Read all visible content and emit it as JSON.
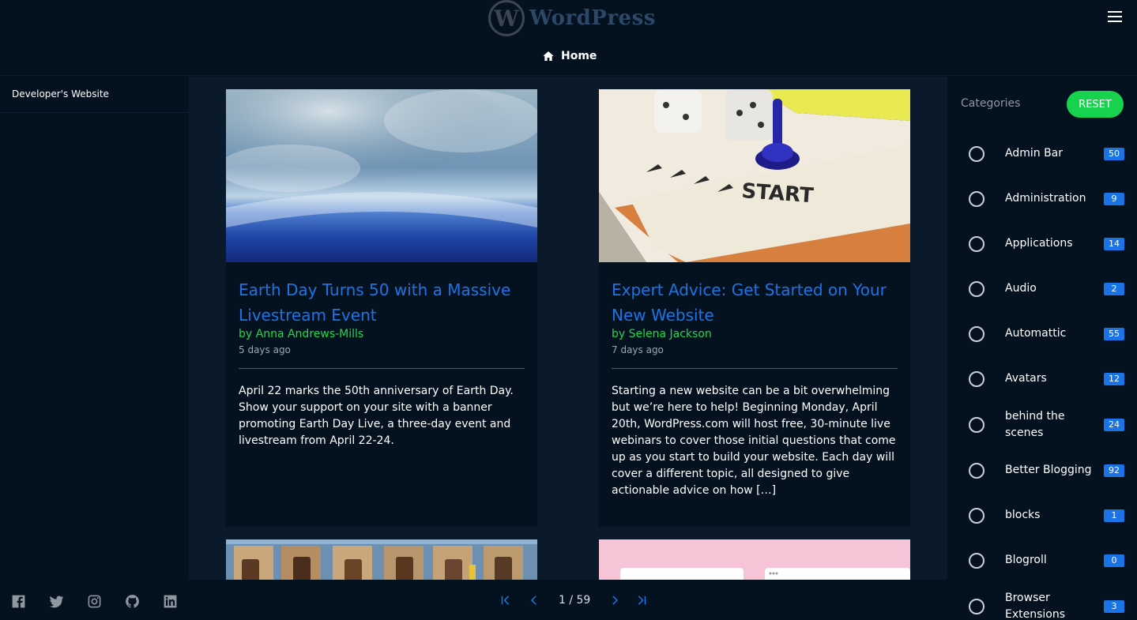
{
  "header": {
    "logo_mark": "W",
    "logo_text": "WordPress",
    "home_label": "Home"
  },
  "left_sidebar": {
    "link_label": "Developer's Website",
    "social_icons": [
      "facebook-icon",
      "twitter-icon",
      "instagram-icon",
      "github-icon",
      "linkedin-icon"
    ]
  },
  "posts": [
    {
      "title": "Earth Day Turns 50 with a Massive Livestream Event",
      "by": "by",
      "author": "Anna Andrews-Mills",
      "time": "5 days ago",
      "excerpt": "April 22 marks the 50th anniversary of Earth Day. Show your support on your site with a banner promoting Earth Day Live, a three-day event and livestream from April 22-24."
    },
    {
      "title": "Expert Advice: Get Started on Your New Website",
      "by": "by",
      "author": "Selena Jackson",
      "time": "7 days ago",
      "excerpt": "Starting a new website can be a bit overwhelming but we’re here to help! Beginning Monday, April 20th, WordPress.com will host free, 30-minute live webinars to cover those initial questions that come up as you start to build your website. Each day will cover a different topic, all designed to give actionable advice on how […]"
    }
  ],
  "pagination": {
    "text": "1 / 59"
  },
  "categories": {
    "heading": "Categories",
    "reset_label": "RESET",
    "items": [
      {
        "label": "Admin Bar",
        "count": "50"
      },
      {
        "label": "Administration",
        "count": "9"
      },
      {
        "label": "Applications",
        "count": "14"
      },
      {
        "label": "Audio",
        "count": "2"
      },
      {
        "label": "Automattic",
        "count": "55"
      },
      {
        "label": "Avatars",
        "count": "12"
      },
      {
        "label": "behind the scenes",
        "count": "24"
      },
      {
        "label": "Better Blogging",
        "count": "92"
      },
      {
        "label": "blocks",
        "count": "1"
      },
      {
        "label": "Blogroll",
        "count": "0"
      },
      {
        "label": "Browser Extensions",
        "count": "3"
      }
    ]
  },
  "colors": {
    "background": "#041220",
    "content_background": "#0b1a2b",
    "link_blue": "#1a74e6",
    "author_green": "#1fd84c",
    "reset_green": "#17d24c"
  }
}
